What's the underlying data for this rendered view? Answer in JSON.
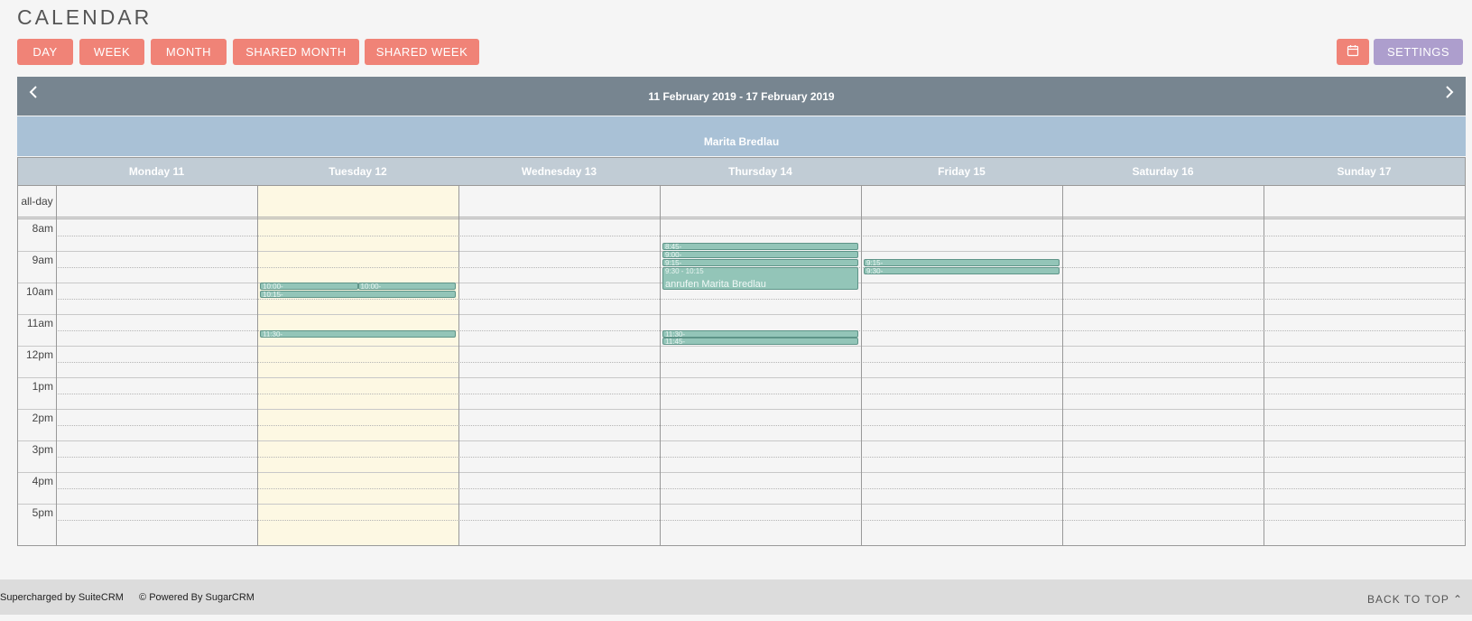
{
  "page": {
    "title": "CALENDAR"
  },
  "toolbar": {
    "views": [
      "DAY",
      "WEEK",
      "MONTH",
      "SHARED MONTH",
      "SHARED WEEK"
    ],
    "settings_label": "SETTINGS",
    "date_picker_icon": "calendar-icon"
  },
  "nav": {
    "range_label": "11 February 2019 - 17 February 2019",
    "prev_icon": "chevron-left-icon",
    "next_icon": "chevron-right-icon"
  },
  "user": {
    "name": "Marita Bredlau"
  },
  "days": [
    "Monday 11",
    "Tuesday 12",
    "Wednesday 13",
    "Thursday 14",
    "Friday 15",
    "Saturday 16",
    "Sunday 17"
  ],
  "all_day_label": "all-day",
  "hours": [
    "8am",
    "9am",
    "10am",
    "11am",
    "12pm",
    "1pm",
    "2pm",
    "3pm",
    "4pm",
    "5pm"
  ],
  "events": [
    {
      "day": 1,
      "start": "10:00",
      "end": "10:15",
      "label": "10:00-",
      "half": "left"
    },
    {
      "day": 1,
      "start": "10:00",
      "end": "10:15",
      "label": "10:00-",
      "half": "right"
    },
    {
      "day": 1,
      "start": "10:15",
      "end": "10:30",
      "label": "10:15-"
    },
    {
      "day": 1,
      "start": "11:30",
      "end": "11:45",
      "label": "11:30-"
    },
    {
      "day": 3,
      "start": "8:45",
      "end": "9:00",
      "label": "8:45-"
    },
    {
      "day": 3,
      "start": "9:00",
      "end": "9:15",
      "label": "9:00-"
    },
    {
      "day": 3,
      "start": "9:15",
      "end": "9:30",
      "label": "9:15-"
    },
    {
      "day": 3,
      "start": "9:30",
      "end": "10:15",
      "label": "9:30 - 10:15",
      "title": "anrufen Marita Bredlau"
    },
    {
      "day": 3,
      "start": "11:30",
      "end": "11:45",
      "label": "11:30-"
    },
    {
      "day": 3,
      "start": "11:45",
      "end": "12:00",
      "label": "11:45-"
    },
    {
      "day": 4,
      "start": "9:15",
      "end": "9:30",
      "label": "9:15-"
    },
    {
      "day": 4,
      "start": "9:30",
      "end": "9:45",
      "label": "9:30-"
    }
  ],
  "footer": {
    "supercharged": "Supercharged by SuiteCRM",
    "powered": "© Powered By SugarCRM",
    "back_to_top": "BACK TO TOP ⌃"
  },
  "colors": {
    "button": "#f08377",
    "settings_button": "#ad9ecd",
    "nav_bar": "#778590",
    "user_bar": "#a9c1d6",
    "day_header": "#c1ccd5",
    "today_column": "#fdf8e3",
    "event": "#93c5b8"
  }
}
